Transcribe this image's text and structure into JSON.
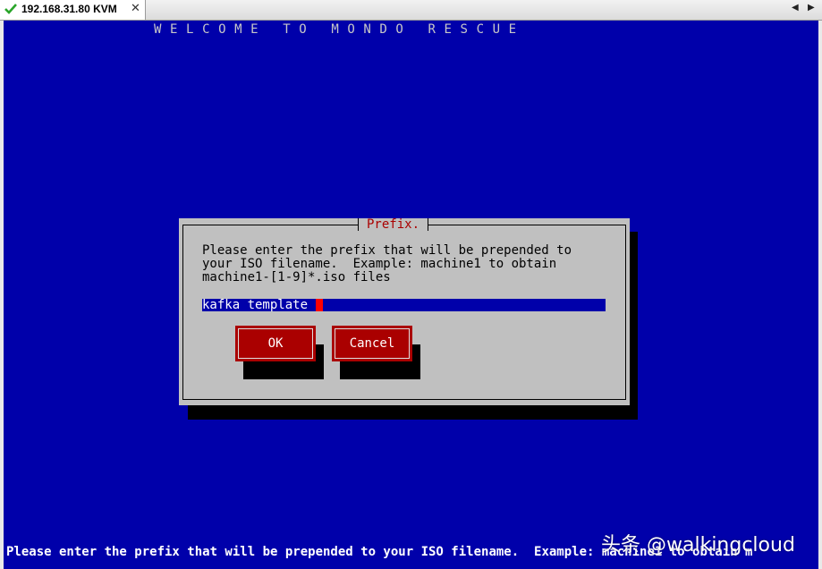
{
  "window": {
    "tab_title": "192.168.31.80 KVM",
    "close_glyph": "✕",
    "nav_left_glyph": "◀",
    "nav_right_glyph": "▶"
  },
  "screen": {
    "header": "WELCOME TO MONDO RESCUE",
    "status_line": "Please enter the prefix that will be prepended to your ISO filename.  Example: machine1 to obtain m",
    "watermark": "头条 @walkingcloud"
  },
  "dialog": {
    "title": "Prefix.",
    "prompt": "Please enter the prefix that will be prepended to\nyour ISO filename.  Example: machine1 to obtain\nmachine1-[1-9]*.iso files",
    "input_value": "kafka_template",
    "ok_label": "OK",
    "cancel_label": "Cancel"
  },
  "colors": {
    "console_bg": "#0000aa",
    "dialog_bg": "#c0c0c0",
    "button_bg": "#aa0000",
    "title_text": "#aa0000",
    "cursor": "#ff0000"
  }
}
